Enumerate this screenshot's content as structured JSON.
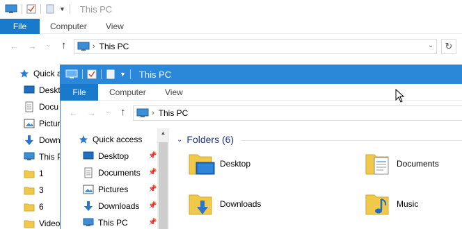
{
  "back_window": {
    "title": "This PC",
    "ribbon": {
      "file": "File",
      "computer": "Computer",
      "view": "View"
    },
    "address": {
      "path": "This PC"
    },
    "nav": [
      {
        "label": "Quick a",
        "icon": "star-icon"
      },
      {
        "label": "Deskt",
        "icon": "desktop-icon"
      },
      {
        "label": "Docu",
        "icon": "document-icon"
      },
      {
        "label": "Pictur",
        "icon": "pictures-icon"
      },
      {
        "label": "Down",
        "icon": "download-icon"
      },
      {
        "label": "This P",
        "icon": "computer-icon"
      },
      {
        "label": "1",
        "icon": "folder-icon"
      },
      {
        "label": "3",
        "icon": "folder-icon"
      },
      {
        "label": "6",
        "icon": "folder-icon"
      },
      {
        "label": "Video",
        "icon": "folder-icon"
      }
    ]
  },
  "front_window": {
    "title": "This PC",
    "ribbon": {
      "file": "File",
      "computer": "Computer",
      "view": "View"
    },
    "address": {
      "path": "This PC"
    },
    "nav": [
      {
        "label": "Quick access",
        "icon": "star-icon",
        "pinned": false
      },
      {
        "label": "Desktop",
        "icon": "desktop-icon",
        "pinned": true
      },
      {
        "label": "Documents",
        "icon": "document-icon",
        "pinned": true
      },
      {
        "label": "Pictures",
        "icon": "pictures-icon",
        "pinned": true
      },
      {
        "label": "Downloads",
        "icon": "download-icon",
        "pinned": true
      },
      {
        "label": "This PC",
        "icon": "computer-icon",
        "pinned": true
      }
    ],
    "folders": {
      "header": "Folders (6)",
      "items": [
        {
          "label": "Desktop",
          "icon": "desktop-folder-icon"
        },
        {
          "label": "Documents",
          "icon": "documents-folder-icon"
        },
        {
          "label": "Downloads",
          "icon": "downloads-folder-icon"
        },
        {
          "label": "Music",
          "icon": "music-folder-icon"
        }
      ]
    }
  },
  "colors": {
    "accent": "#2b88d8",
    "file_tab": "#1979ca",
    "folder": "#f0c84a",
    "group_header": "#1e3287"
  }
}
